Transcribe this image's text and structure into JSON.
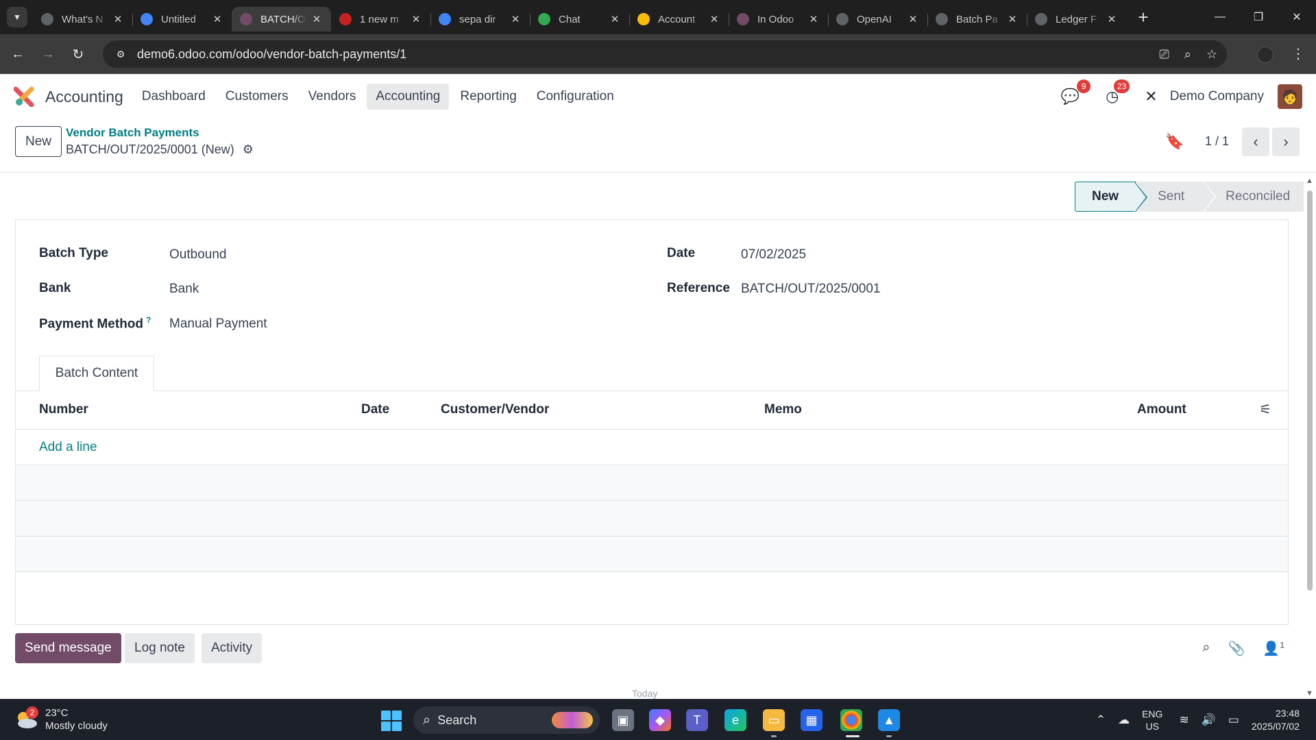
{
  "browser": {
    "tabs": [
      {
        "title": "What's N",
        "favicon": "globe-icon",
        "color": "#5f6368"
      },
      {
        "title": "Untitled",
        "favicon": "docs-icon",
        "color": "#4285f4"
      },
      {
        "title": "BATCH/O",
        "favicon": "odoo-icon",
        "color": "#714b67",
        "active": true
      },
      {
        "title": "1 new m",
        "favicon": "mail-icon",
        "color": "#c5221f"
      },
      {
        "title": "sepa dir",
        "favicon": "google-icon",
        "color": "#4285f4"
      },
      {
        "title": "Chat",
        "favicon": "chat-icon",
        "color": "#34a853"
      },
      {
        "title": "Account",
        "favicon": "drive-icon",
        "color": "#fbbc04"
      },
      {
        "title": "In Odoo",
        "favicon": "odoo-icon",
        "color": "#714b67"
      },
      {
        "title": "OpenAI",
        "favicon": "openai-icon",
        "color": "#5f6368"
      },
      {
        "title": "Batch Pa",
        "favicon": "openai-icon",
        "color": "#5f6368"
      },
      {
        "title": "Ledger F",
        "favicon": "openai-icon",
        "color": "#5f6368"
      }
    ],
    "url": "demo6.odoo.com/odoo/vendor-batch-payments/1"
  },
  "navbar": {
    "app_name": "Accounting",
    "menu": [
      "Dashboard",
      "Customers",
      "Vendors",
      "Accounting",
      "Reporting",
      "Configuration"
    ],
    "active_menu": "Accounting",
    "messages_count": "9",
    "activities_count": "23",
    "company": "Demo Company"
  },
  "control_panel": {
    "new_label": "New",
    "breadcrumb_parent": "Vendor Batch Payments",
    "record_title": "BATCH/OUT/2025/0001 (New)",
    "pager": "1 / 1"
  },
  "status": {
    "stages": [
      "New",
      "Sent",
      "Reconciled"
    ],
    "current": "New"
  },
  "form": {
    "batch_type_label": "Batch Type",
    "batch_type": "Outbound",
    "bank_label": "Bank",
    "bank": "Bank",
    "payment_method_label": "Payment Method",
    "payment_method_help": "?",
    "payment_method": "Manual Payment",
    "date_label": "Date",
    "date": "07/02/2025",
    "reference_label": "Reference",
    "reference": "BATCH/OUT/2025/0001"
  },
  "notebook": {
    "tab": "Batch Content",
    "columns": [
      "Number",
      "Date",
      "Customer/Vendor",
      "Memo",
      "Amount"
    ],
    "add_line": "Add a line"
  },
  "chatter": {
    "send_message": "Send message",
    "log_note": "Log note",
    "activity": "Activity",
    "followers_count": "1",
    "today": "Today"
  },
  "taskbar": {
    "weather_temp": "23°C",
    "weather_desc": "Mostly cloudy",
    "weather_badge": "2",
    "search_label": "Search",
    "lang_line1": "ENG",
    "lang_line2": "US",
    "time": "23:48",
    "date": "2025/07/02"
  },
  "colors": {
    "odoo_primary": "#714b67",
    "odoo_link": "#017e84",
    "badge_red": "#e03c3c"
  }
}
